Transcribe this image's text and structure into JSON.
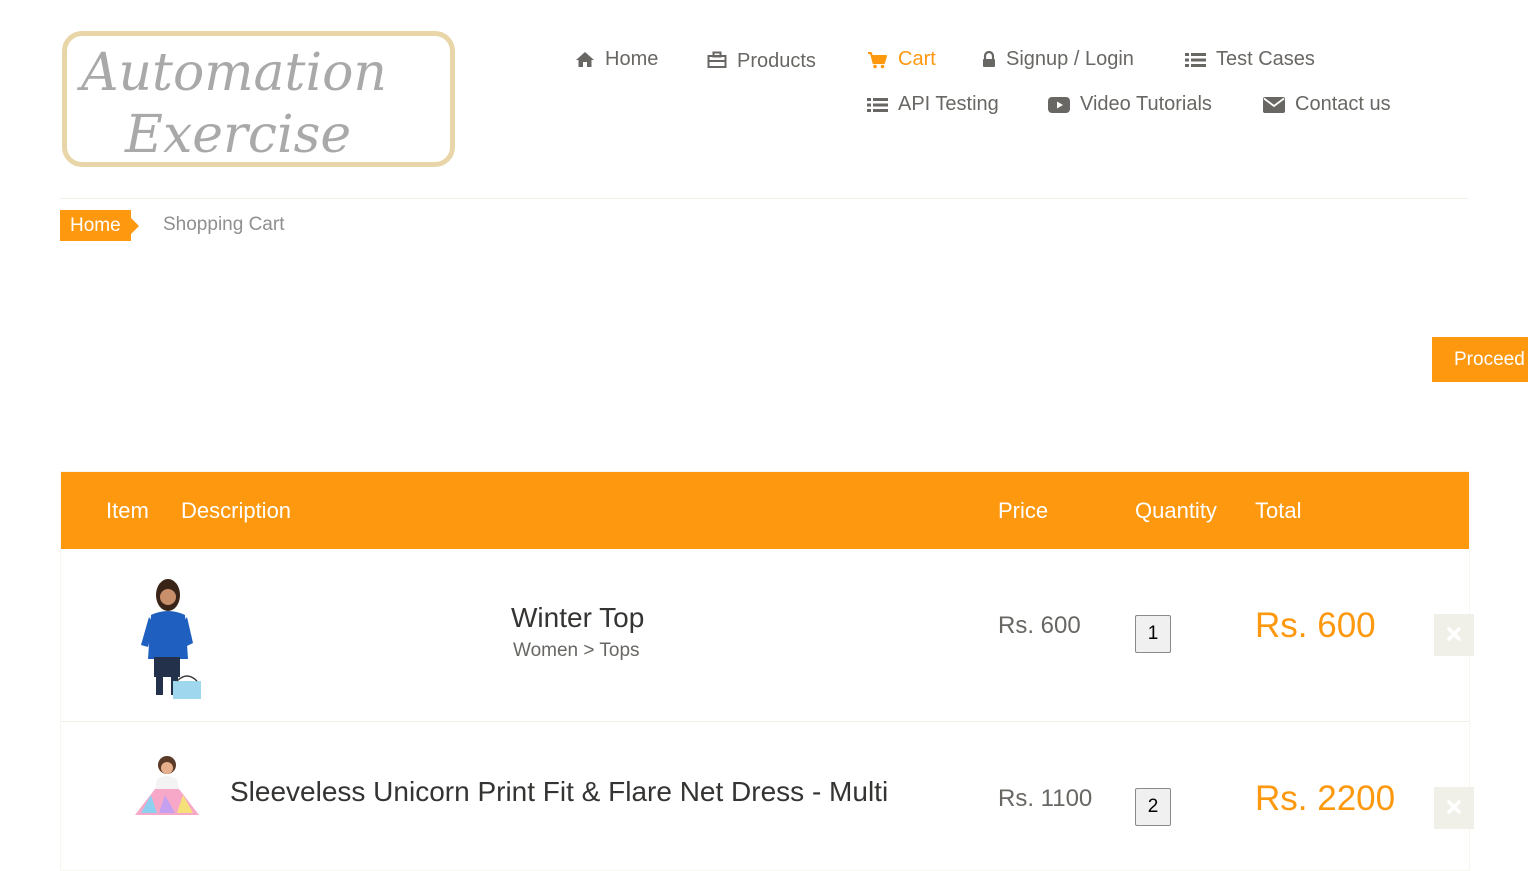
{
  "logo": {
    "line1": "Automation",
    "line2": "Exercise"
  },
  "nav": {
    "home": "Home",
    "products": "Products",
    "cart": "Cart",
    "signup_login": "Signup / Login",
    "test_cases": "Test Cases",
    "api_testing": "API Testing",
    "video_tutorials": "Video Tutorials",
    "contact_us": "Contact us",
    "active": "cart"
  },
  "breadcrumb": {
    "home": "Home",
    "current": "Shopping Cart"
  },
  "checkout": {
    "proceed_label": "Proceed To Checkout"
  },
  "cart_table": {
    "headers": {
      "item": "Item",
      "description": "Description",
      "price": "Price",
      "quantity": "Quantity",
      "total": "Total"
    },
    "rows": [
      {
        "name": "Winter Top",
        "category": "Women > Tops",
        "price": "Rs. 600",
        "quantity": "1",
        "total": "Rs. 600"
      },
      {
        "name": "Sleeveless Unicorn Print Fit & Flare Net Dress - Multi",
        "category": "",
        "price": "Rs. 1100",
        "quantity": "2",
        "total": "Rs. 2200"
      }
    ]
  },
  "icons": {
    "home": "home-icon",
    "products": "briefcase-icon",
    "cart": "shopping-cart-icon",
    "signup": "lock-icon",
    "test_cases": "list-icon",
    "api": "list-icon",
    "video": "youtube-play-icon",
    "contact": "envelope-icon",
    "delete": "close-icon"
  },
  "colors": {
    "accent": "#FE980F",
    "text": "#696763",
    "dark_text": "#363432"
  }
}
